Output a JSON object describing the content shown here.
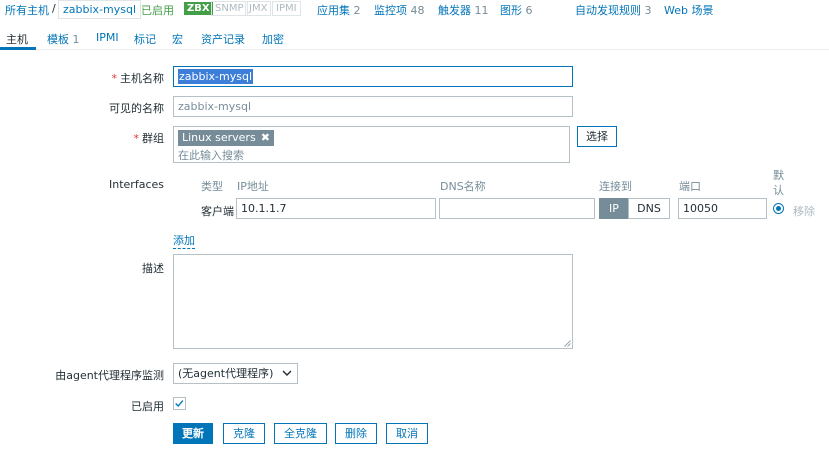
{
  "breadcrumb": {
    "all_hosts": "所有主机",
    "separator": "/",
    "current_host": "zabbix-mysql",
    "status": "已启用",
    "availability": {
      "zbx": "ZBX",
      "snmp": "SNMP",
      "jmx": "JMX",
      "ipmi": "IPMI"
    }
  },
  "top_links": [
    {
      "label": "应用集",
      "count": "2"
    },
    {
      "label": "监控项",
      "count": "48"
    },
    {
      "label": "触发器",
      "count": "11"
    },
    {
      "label": "图形",
      "count": "6"
    },
    {
      "label": "自动发现规则",
      "count": "3"
    },
    {
      "label": "Web 场景",
      "count": ""
    }
  ],
  "tabs": {
    "host": "主机",
    "templates": "模板",
    "templates_count": "1",
    "ipmi": "IPMI",
    "tags": "标记",
    "macros": "宏",
    "inventory": "资产记录",
    "encryption": "加密"
  },
  "form": {
    "host_name_label": "主机名称",
    "host_name_value": "zabbix-mysql",
    "visible_name_label": "可见的名称",
    "visible_name_placeholder": "zabbix-mysql",
    "groups_label": "群组",
    "group_chip": "Linux servers",
    "group_search_placeholder": "在此输入搜索",
    "select_button": "选择",
    "interfaces_label": "Interfaces",
    "iface_headers": {
      "type": "类型",
      "ip": "IP地址",
      "dns": "DNS名称",
      "connect": "连接到",
      "port": "端口",
      "default": "默认"
    },
    "iface_row": {
      "type": "客户端",
      "ip": "10.1.1.7",
      "dns": "",
      "connect_ip": "IP",
      "connect_dns": "DNS",
      "port": "10050",
      "remove": "移除"
    },
    "add_link": "添加",
    "description_label": "描述",
    "proxy_label": "由agent代理程序监测",
    "proxy_value": "(无agent代理程序)",
    "enabled_label": "已启用"
  },
  "buttons": {
    "update": "更新",
    "clone": "克隆",
    "full_clone": "全克隆",
    "delete": "删除",
    "cancel": "取消"
  },
  "colors": {
    "link": "#0275b8",
    "enabled": "#429e47",
    "required": "#e33734",
    "muted": "#768d99"
  }
}
